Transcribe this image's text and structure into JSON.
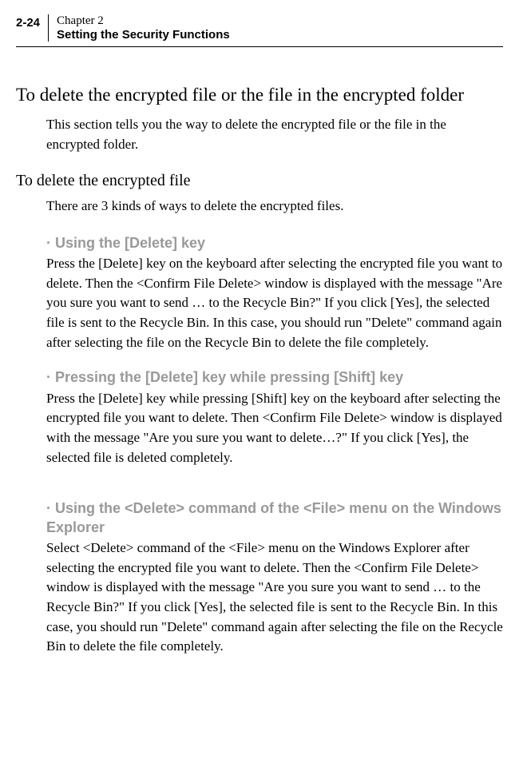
{
  "header": {
    "page_number": "2-24",
    "chapter": "Chapter 2",
    "subtitle": "Setting the Security Functions"
  },
  "section": {
    "title": "To delete the encrypted file or the file in the encrypted folder",
    "intro": "This section tells you the way to delete the encrypted file or the file in the encrypted folder."
  },
  "subsection": {
    "title": "To delete the encrypted file",
    "intro": "There are 3 kinds of ways to delete the encrypted files."
  },
  "methods": [
    {
      "title": "· Using the [Delete] key",
      "body": "Press the [Delete] key on the keyboard after selecting the encrypted file you want to delete. Then the <Confirm File Delete> window is displayed with the message \"Are you sure you want to send … to the Recycle Bin?\" If you click [Yes], the selected file is sent to the Recycle Bin. In this case, you should run \"Delete\" command again after selecting the file on the Recycle Bin to delete the file completely."
    },
    {
      "title": "· Pressing the [Delete] key while pressing [Shift] key",
      "body": "Press the [Delete] key while pressing [Shift] key on the keyboard after selecting the encrypted file you want to delete. Then <Confirm File Delete> window is displayed with the message \"Are you sure you want to delete…?\" If you click [Yes], the selected file is deleted completely."
    },
    {
      "title": "· Using the <Delete> command of the <File> menu on the Windows Explorer",
      "body": "Select <Delete> command of the <File> menu on the Windows Explorer after selecting the encrypted file you want to delete. Then the <Confirm File Delete> window is displayed with the message \"Are you sure you want to send … to the Recycle Bin?\" If you click [Yes], the selected file is sent to the Recycle Bin. In this case, you should run \"Delete\" command again after selecting the file on the Recycle Bin to delete the file completely."
    }
  ]
}
